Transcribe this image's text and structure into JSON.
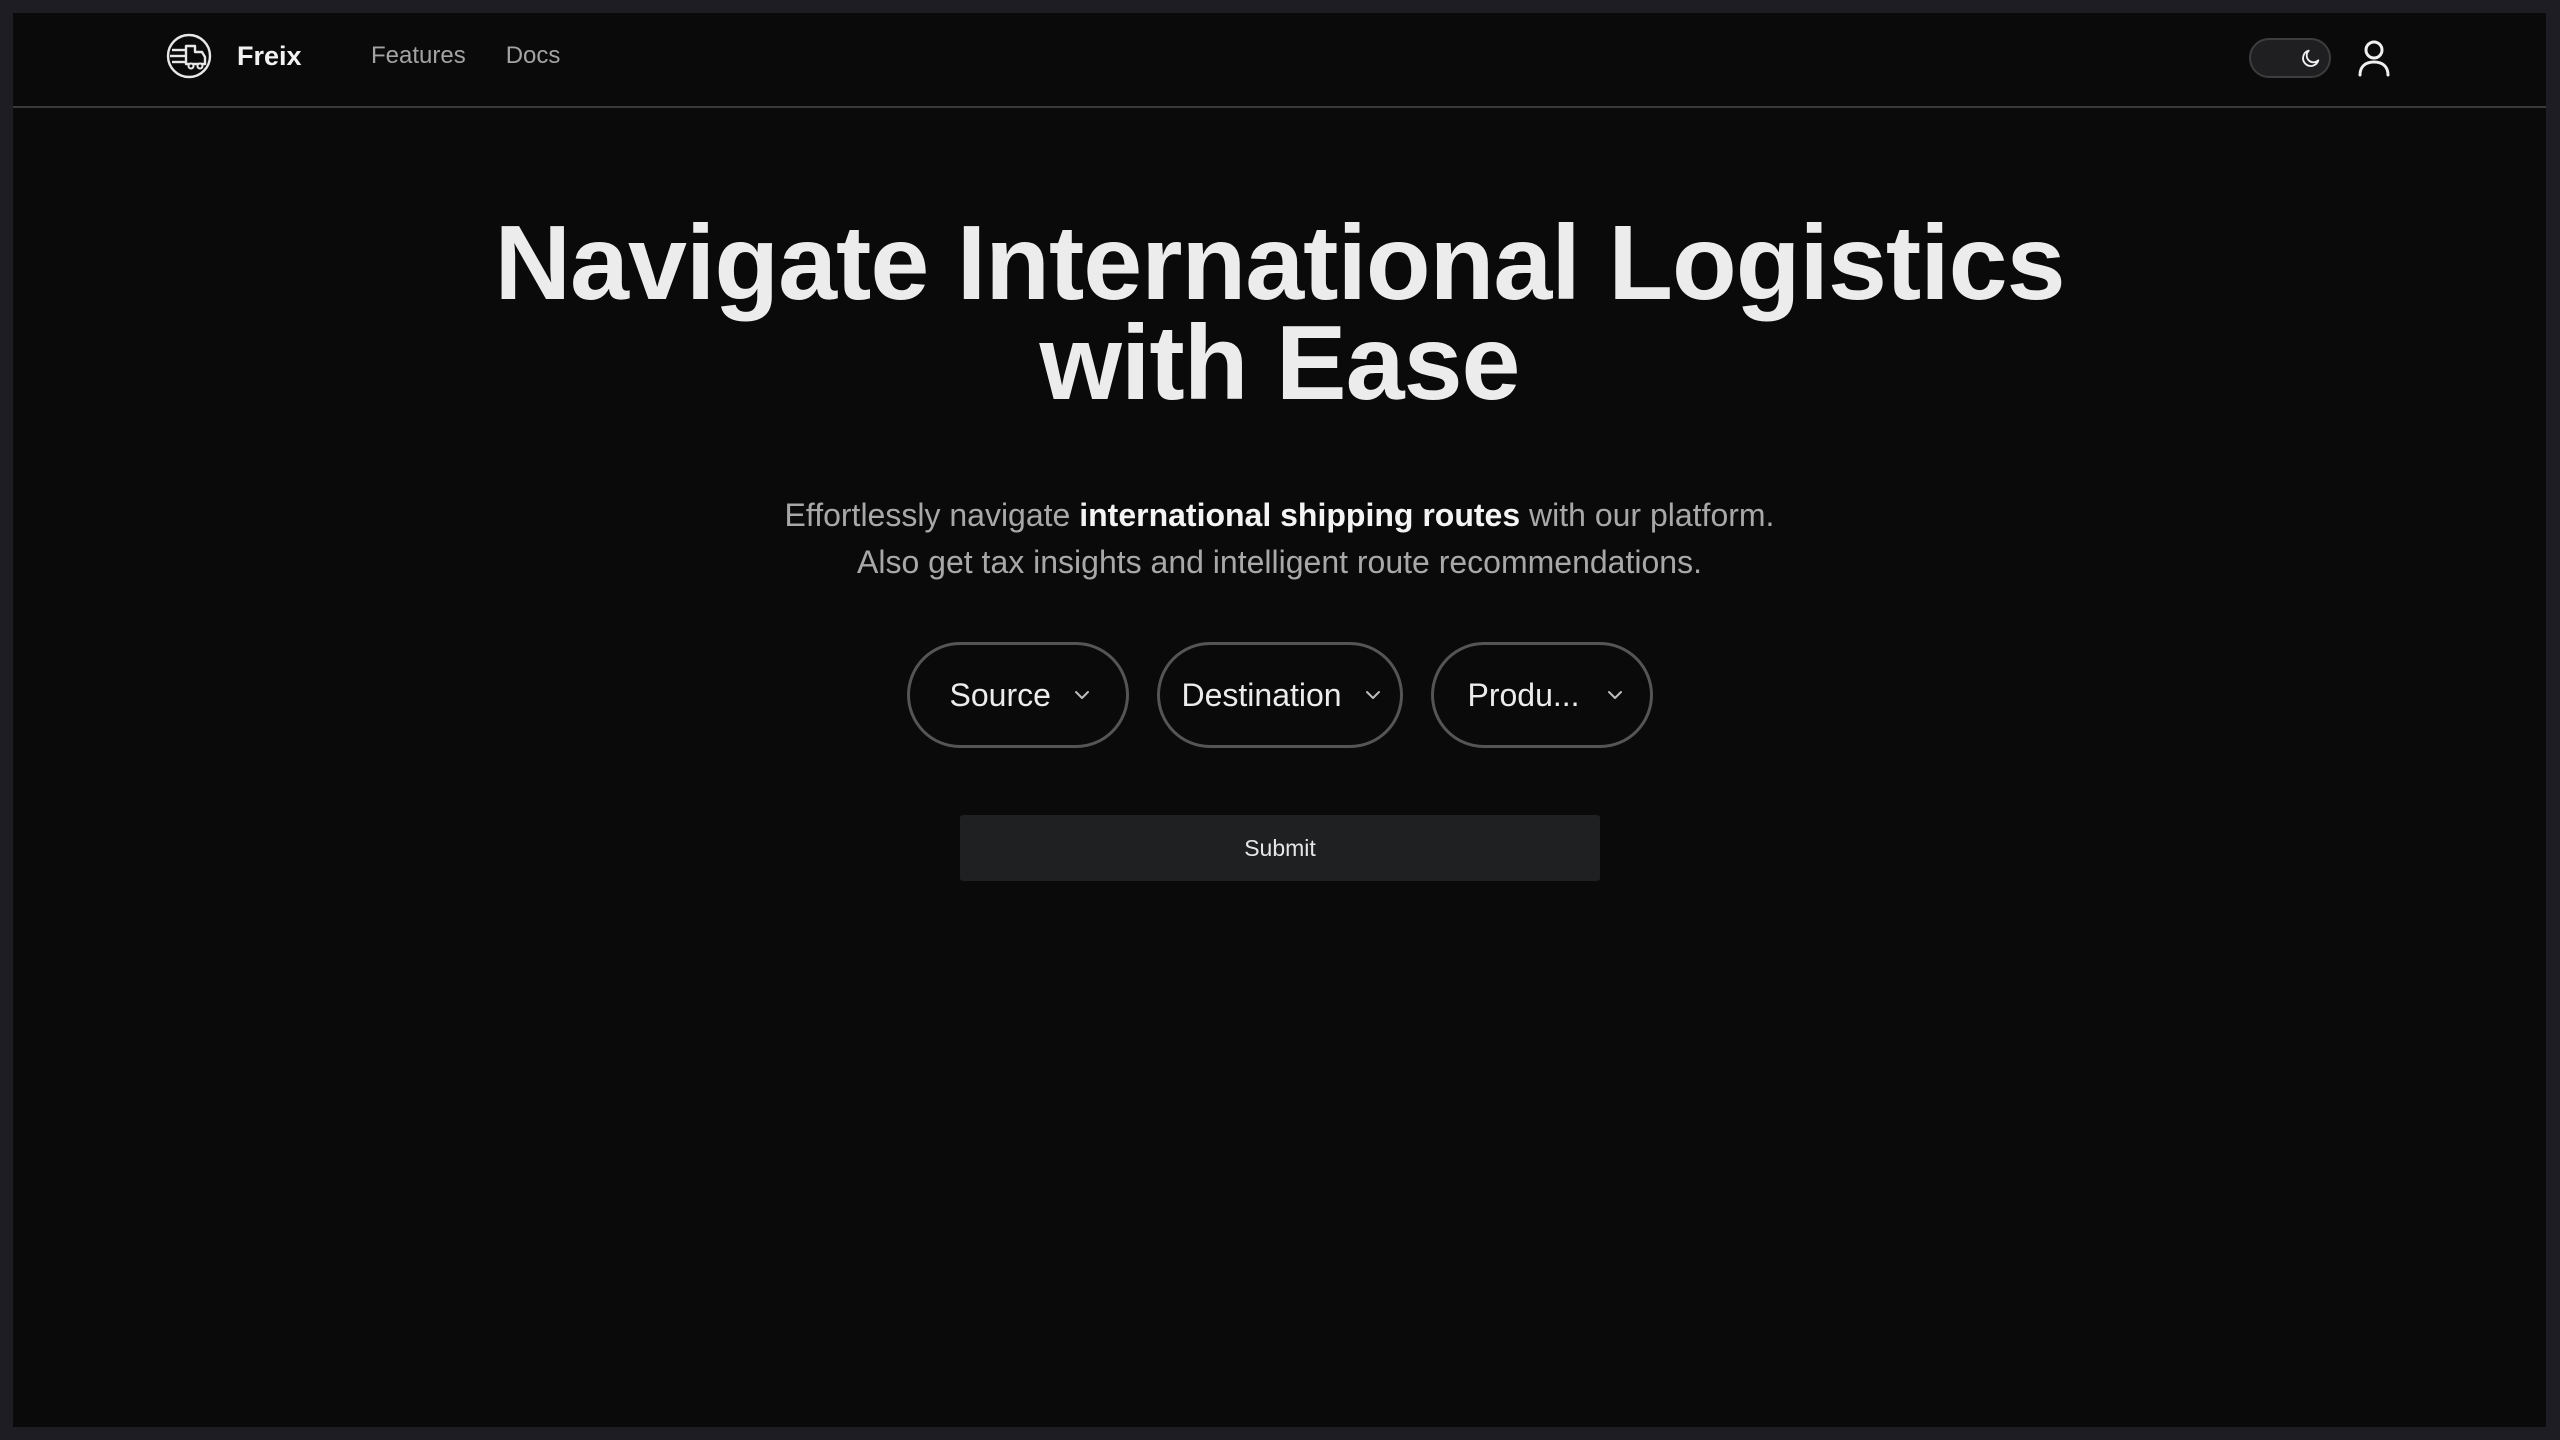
{
  "brand": {
    "name": "Freix",
    "logo_icon": "shipping-globe-icon"
  },
  "nav": {
    "links": [
      "Features",
      "Docs"
    ]
  },
  "header_actions": {
    "theme_toggle_icon": "moon-icon",
    "theme_mode": "dark",
    "user_icon": "user-icon"
  },
  "hero": {
    "title_line1": "Navigate International Logistics",
    "title_line2": "with Ease",
    "subtitle_pre": "Effortlessly navigate ",
    "subtitle_bold": "international shipping routes",
    "subtitle_post": " with our platform.",
    "subtitle_line2": "Also get tax insights and intelligent route recommendations."
  },
  "form": {
    "selects": [
      {
        "label": "Source",
        "icon": "chevron-down-icon"
      },
      {
        "label": "Destination",
        "icon": "chevron-down-icon"
      },
      {
        "label": "Produ...",
        "icon": "chevron-down-icon"
      }
    ],
    "submit_label": "Submit"
  },
  "colors": {
    "background": "#0a0a0a",
    "outer_frame": "#1d1d23",
    "text_primary": "#ececec",
    "text_muted": "#a8a8a8",
    "border": "#555555",
    "button_bg": "#1f2022"
  }
}
